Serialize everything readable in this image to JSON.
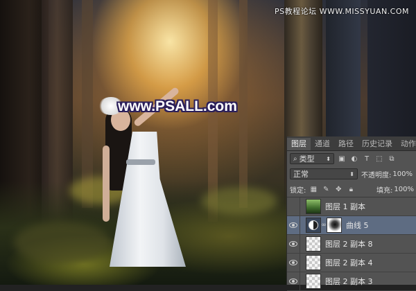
{
  "watermark_top": "PS教程论坛 WWW.MISSYUAN.COM",
  "watermark_main": "www.PSALL.com",
  "panel": {
    "tabs": [
      "图层",
      "通道",
      "路径",
      "历史记录",
      "动作"
    ],
    "active_tab": 0,
    "filter_label": "类型",
    "blend_mode": "正常",
    "opacity_label": "不透明度:",
    "opacity_value": "100%",
    "lock_label": "锁定:",
    "fill_label": "填充:",
    "fill_value": "100%",
    "layers": [
      {
        "name": "图层 1 副本",
        "visible": false,
        "thumb": "forest",
        "selected": false
      },
      {
        "name": "曲线 5",
        "visible": true,
        "thumb": "curves",
        "selected": true
      },
      {
        "name": "图层 2 副本 8",
        "visible": true,
        "thumb": "transparent",
        "selected": false
      },
      {
        "name": "图层 2 副本 4",
        "visible": true,
        "thumb": "transparent",
        "selected": false
      },
      {
        "name": "图层 2 副本 3",
        "visible": true,
        "thumb": "transparent",
        "selected": false
      }
    ]
  },
  "colors": {
    "accent_selected": "#5e6c82",
    "panel_bg": "#535353"
  }
}
